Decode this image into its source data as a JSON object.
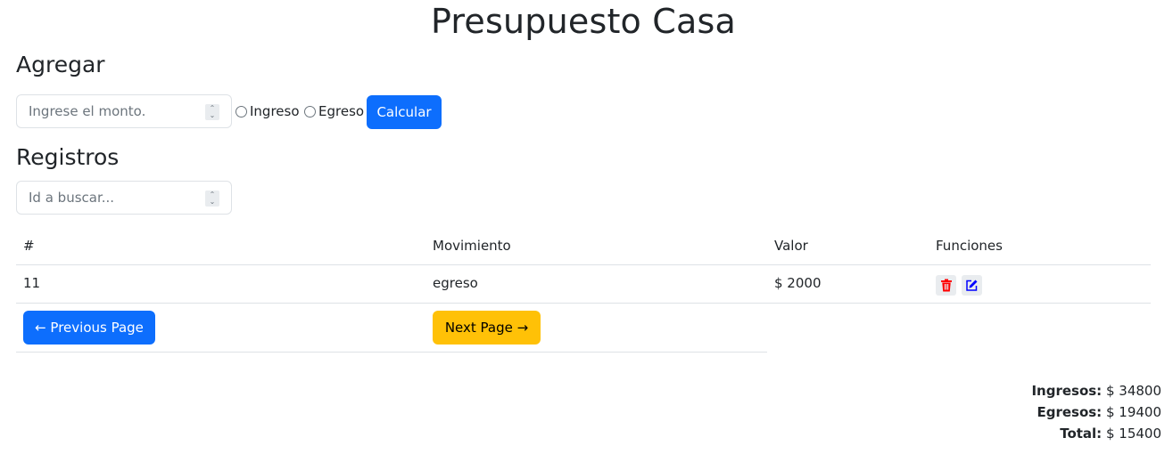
{
  "title": "Presupuesto Casa",
  "agregar": {
    "heading": "Agregar",
    "amount_placeholder": "Ingrese el monto.",
    "radio_ingreso": "Ingreso",
    "radio_egreso": "Egreso",
    "calc_label": "Calcular"
  },
  "registros": {
    "heading": "Registros",
    "search_placeholder": "Id a buscar...",
    "columns": [
      "#",
      "Movimiento",
      "Valor",
      "Funciones"
    ],
    "rows": [
      {
        "id": "11",
        "movimiento": "egreso",
        "valor": "$ 2000"
      }
    ],
    "prev_label": "← Previous Page",
    "next_label": "Next Page →"
  },
  "totals": {
    "ingresos_label": "Ingresos:",
    "ingresos_value": "$ 34800",
    "egresos_label": "Egresos:",
    "egresos_value": "$ 19400",
    "total_label": "Total:",
    "total_value": "$ 15400"
  },
  "icons": {
    "delete": "trash-icon",
    "edit": "pencil-square-icon"
  },
  "colors": {
    "primary": "#0d6efd",
    "warning": "#ffc107",
    "danger": "#ff0000",
    "edit": "#0000ff"
  }
}
